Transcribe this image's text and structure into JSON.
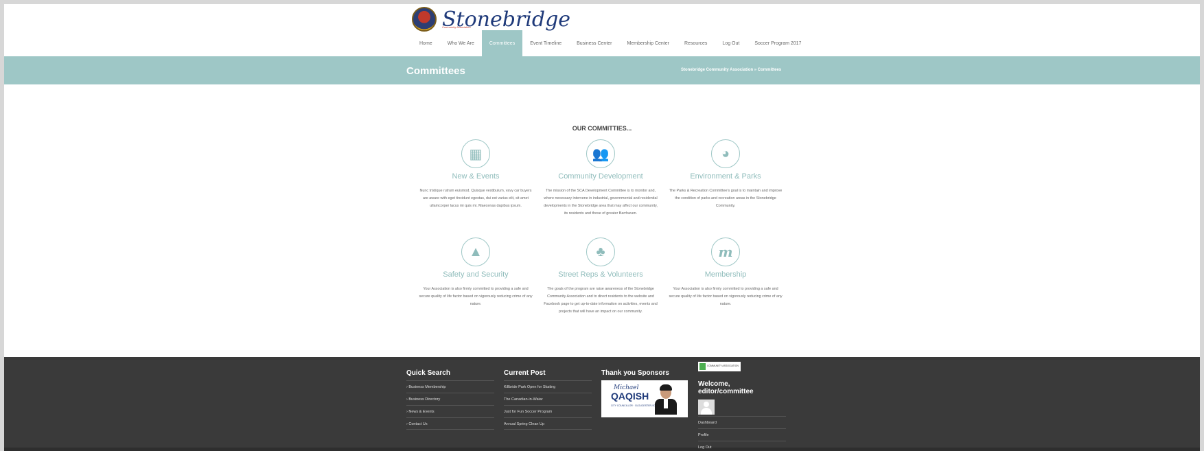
{
  "header": {
    "logo_text": "Stonebridge",
    "logo_sub": "Community Association"
  },
  "nav": {
    "items": [
      "Home",
      "Who We Are",
      "Committees",
      "Event Timeline",
      "Business Center",
      "Membership Center",
      "Resources",
      "Log Out",
      "Soccer Program 2017"
    ],
    "active": "Committees"
  },
  "banner": {
    "title": "Committees",
    "breadcrumb": "Stonebridge Community Association » Committees"
  },
  "committees": {
    "heading": "OUR COMMITTIES...",
    "items": [
      {
        "icon": "calendar-icon",
        "glyph": "▦",
        "title": "New & Events",
        "text": "Nunc tristique rutrum euismod. Quisque vestibulum, vavy car buyers are aware with eget tincidunt egestas, dui est varius elit, sit amet ullamcorper lacus mi quis mi. Maecenas dapibus ipsum."
      },
      {
        "icon": "people-icon",
        "glyph": "👥",
        "title": "Community Development",
        "text": "The mission of the SCA Development Committee is to monitor and, where necessary intervene in industrial, governmental and residential developments in the Stonebridge area that may affect our community, its residents and those of greater Barrhaven."
      },
      {
        "icon": "globe-icon",
        "glyph": "◕",
        "title": "Environment & Parks",
        "text": "The Parks & Recreation Committee's goal is to maintain and improve the condition of parks and recreation areas in the Stonebridge Community."
      },
      {
        "icon": "warning-icon",
        "glyph": "▲",
        "title": "Safety and Security",
        "text": "Your Association is also firmly committed to providing a safe and secure quality of life factor based on vigorously reducing crime of any nature."
      },
      {
        "icon": "volunteer-icon",
        "glyph": "♣",
        "title": "Street Reps & Volunteers",
        "text": "The goals of the program are raise awareness of the Stonebridge Community Association and to direct residents to the website and Facebook page to get up-to-date information on activities, events and projects that will have an impact on our community."
      },
      {
        "icon": "membership-icon",
        "glyph": "m",
        "title": "Membership",
        "text": "Your Association is also firmly committed to providing a safe and secure quality of life factor based on vigorously reducing crime of any nature."
      }
    ]
  },
  "footer": {
    "quick_search": {
      "title": "Quick Search",
      "items": [
        "Business Membership",
        "Business Directory",
        "News & Events",
        "Contact Us"
      ]
    },
    "current_post": {
      "title": "Current Post",
      "items": [
        "Killbride Park Open for Skating",
        "The Canadian-in-Waiar",
        "Just for Fun Soccer Program",
        "Annual Spring Clean Up"
      ]
    },
    "sponsors": {
      "title": "Thank you Sponsors",
      "sponsor_first": "Michael",
      "sponsor_last": "QAQISH",
      "sponsor_sub": "CITY COUNCILLOR · GLOUCESTER-SOUTH NEPEAN"
    },
    "account": {
      "badge": "COMMUNITY ASSOCIATION",
      "welcome": "Welcome, editor/committee",
      "links": [
        "Dashboard",
        "Profile",
        "Log Out"
      ]
    }
  }
}
